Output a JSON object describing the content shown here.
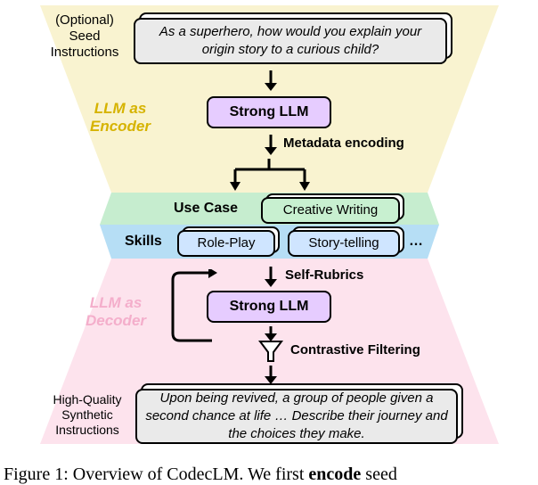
{
  "seed": {
    "label": "(Optional)\nSeed\nInstructions",
    "text": "As a superhero, how would you explain your origin story to a curious child?"
  },
  "encoder_label": "LLM as\nEncoder",
  "strong_llm": "Strong LLM",
  "metadata_encoding": "Metadata encoding",
  "use_case": {
    "label": "Use Case",
    "value": "Creative Writing"
  },
  "skills": {
    "label": "Skills",
    "items": [
      "Role-Play",
      "Story-telling"
    ],
    "ellipsis": "…"
  },
  "self_rubrics": "Self-Rubrics",
  "decoder_label": "LLM as\nDecoder",
  "contrastive_filtering": "Contrastive Filtering",
  "synthetic": {
    "label": "High-Quality\nSynthetic\nInstructions",
    "text": "Upon being revived, a group of people given a second chance at life … Describe their journey and the choices they make."
  },
  "caption": {
    "prefix": "Figure 1: Overview of CodecLM. We first ",
    "strong": "encode",
    "suffix": " seed"
  },
  "colors": {
    "beige": "#f9f3d0",
    "green_band": "#c6edcf",
    "blue_band": "#b6def5",
    "pink": "#fde3ed"
  }
}
